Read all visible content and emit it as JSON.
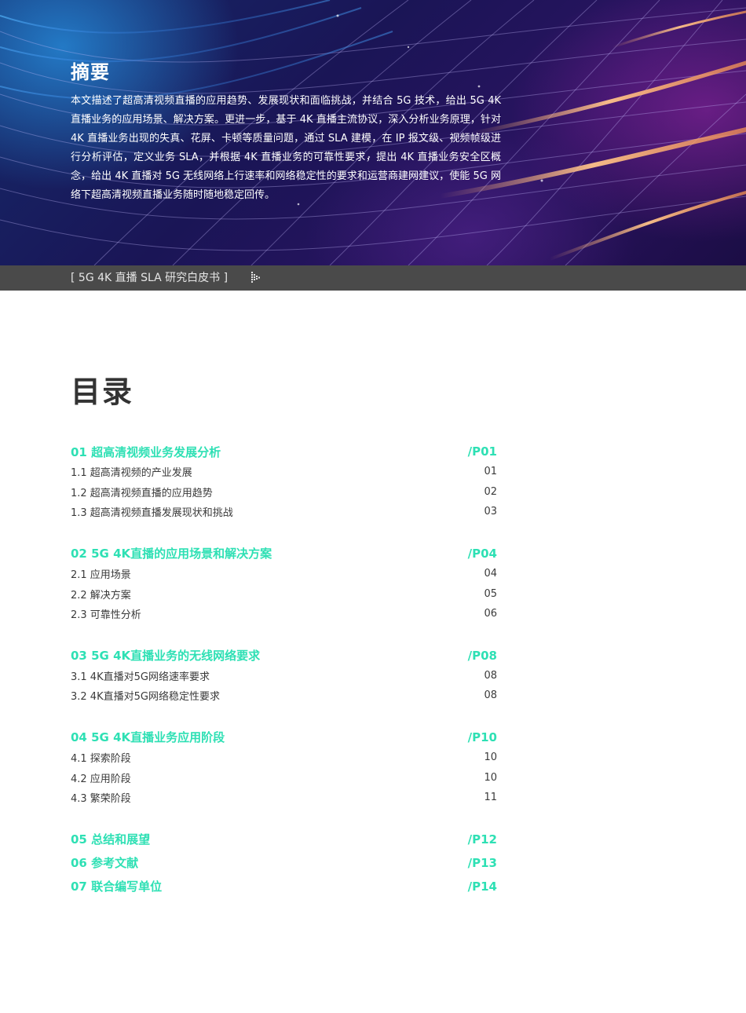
{
  "abstract": {
    "title": "摘要",
    "body": "本文描述了超高清视频直播的应用趋势、发展现状和面临挑战，并结合 5G 技术，给出 5G 4K 直播业务的应用场景、解决方案。更进一步，基于 4K 直播主流协议，深入分析业务原理，针对 4K 直播业务出现的失真、花屏、卡顿等质量问题，通过 SLA 建模，在 IP 报文级、视频帧级进行分析评估，定义业务 SLA，并根据 4K 直播业务的可靠性要求，提出 4K 直播业务安全区概念，给出 4K 直播对 5G 无线网络上行速率和网络稳定性的要求和运营商建网建议，使能 5G 网络下超高清视频直播业务随时随地稳定回传。"
  },
  "band": {
    "label": "[ 5G 4K 直播 SLA 研究白皮书 ]"
  },
  "toc": {
    "title": "目录",
    "sections": [
      {
        "title": "01 超高清视频业务发展分析",
        "page": "/P01",
        "items": [
          {
            "title": "1.1 超高清视频的产业发展",
            "page": "01"
          },
          {
            "title": "1.2 超高清视频直播的应用趋势",
            "page": "02"
          },
          {
            "title": "1.3 超高清视频直播发展现状和挑战",
            "page": "03"
          }
        ]
      },
      {
        "title": "02 5G 4K直播的应用场景和解决方案",
        "page": "/P04",
        "items": [
          {
            "title": "2.1 应用场景",
            "page": "04"
          },
          {
            "title": "2.2 解决方案",
            "page": "05"
          },
          {
            "title": "2.3 可靠性分析",
            "page": "06"
          }
        ]
      },
      {
        "title": "03 5G 4K直播业务的无线网络要求",
        "page": "/P08",
        "items": [
          {
            "title": "3.1 4K直播对5G网络速率要求",
            "page": "08"
          },
          {
            "title": "3.2 4K直播对5G网络稳定性要求",
            "page": "08"
          }
        ]
      },
      {
        "title": "04 5G 4K直播业务应用阶段",
        "page": "/P10",
        "items": [
          {
            "title": "4.1 探索阶段",
            "page": "10"
          },
          {
            "title": "4.2 应用阶段",
            "page": "10"
          },
          {
            "title": "4.3 繁荣阶段",
            "page": "11"
          }
        ]
      },
      {
        "title": "05 总结和展望",
        "page": "/P12",
        "items": []
      },
      {
        "title": "06 参考文献",
        "page": "/P13",
        "items": []
      },
      {
        "title": "07 联合编写单位",
        "page": "/P14",
        "items": []
      }
    ]
  },
  "colors": {
    "accent": "#2ee0b4",
    "band": "#4a4a4a",
    "text": "#3a3a3a"
  }
}
